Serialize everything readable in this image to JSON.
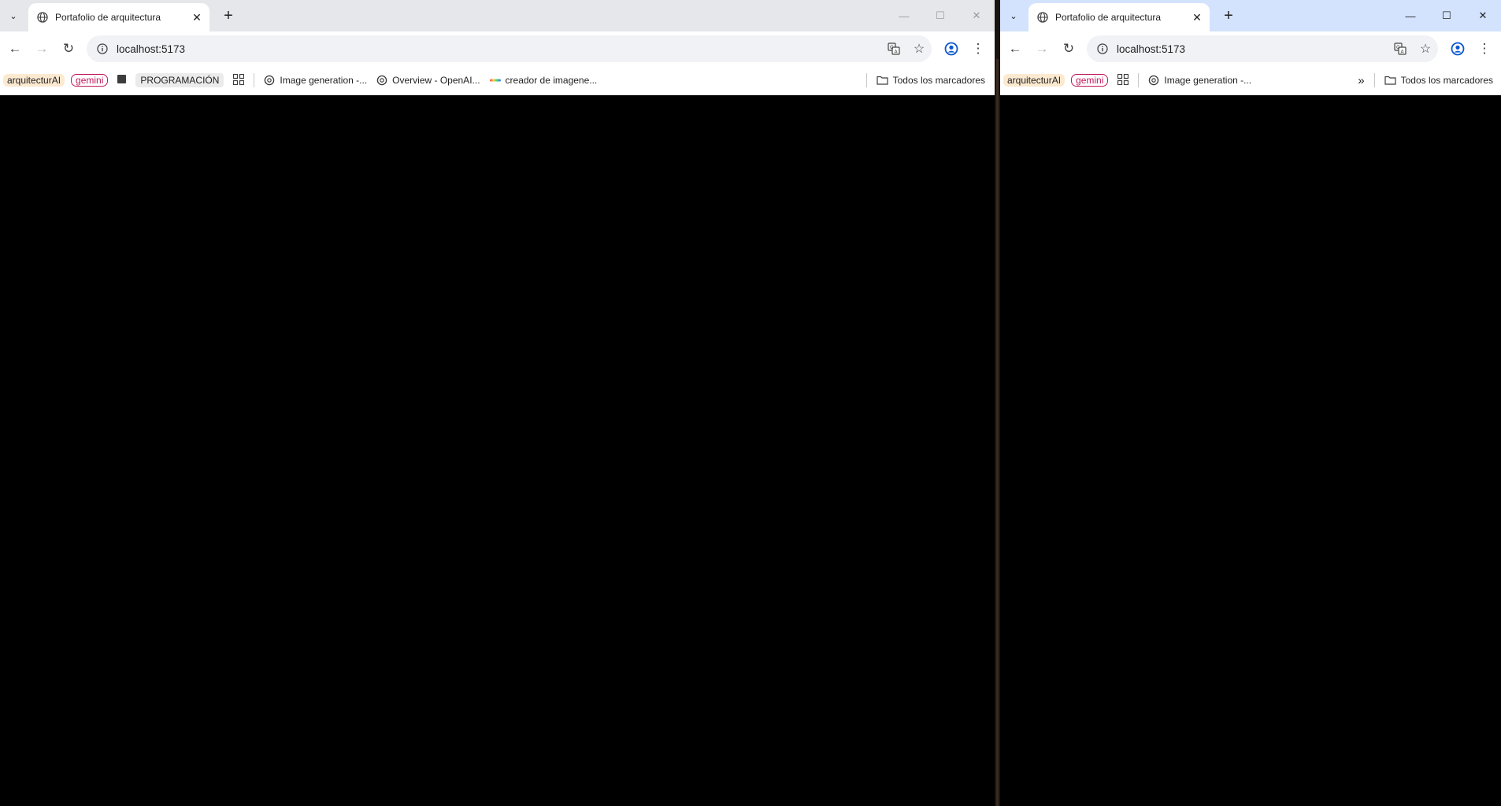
{
  "windows": [
    {
      "tab_title": "Portafolio de arquitectura",
      "url": "localhost:5173",
      "window_state": "inactive",
      "bookmarks": [
        "arquitecturAI",
        "gemini",
        "PROGRAMACIÓN",
        "Image generation -...",
        "Overview - OpenAI...",
        "creador de imagene..."
      ],
      "all_bookmarks": "Todos los marcadores"
    },
    {
      "tab_title": "Portafolio de arquitectura",
      "url": "localhost:5173",
      "window_state": "active",
      "bookmarks": [
        "arquitecturAI",
        "gemini",
        "Image generation -..."
      ],
      "overflow_icon": "chevron-double-right-icon",
      "all_bookmarks": "Todos los marcadores"
    }
  ],
  "colors": {
    "gemini_chip": "#c2185b",
    "arquitectura_chip_bg": "#fbe9d0",
    "active_tabstrip": "#d3e3fd",
    "inactive_tabstrip": "#e6e7ea",
    "profile_icon": "#0b57d0",
    "page_background": "#000000"
  }
}
